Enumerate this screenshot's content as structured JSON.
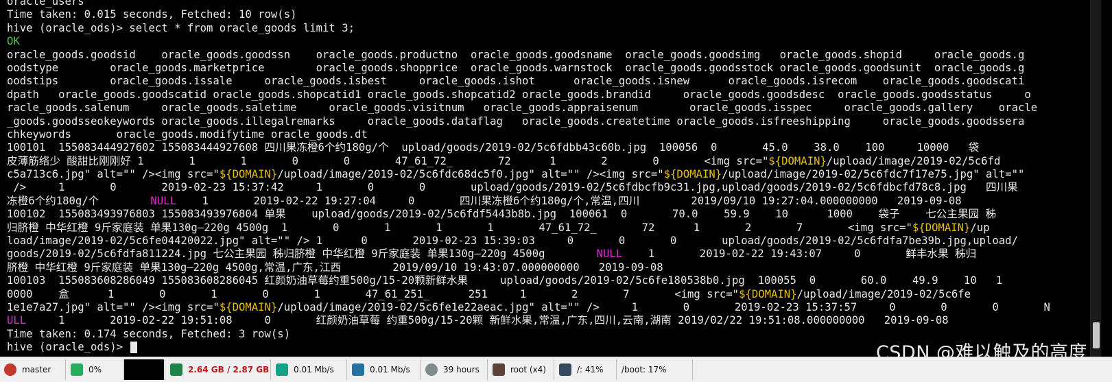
{
  "terminal": {
    "lines": [
      {
        "segments": [
          {
            "t": "oracle_users"
          }
        ]
      },
      {
        "segments": [
          {
            "t": "Time taken: 0.015 seconds, Fetched: 10 row(s)"
          }
        ]
      },
      {
        "segments": [
          {
            "t": "hive (oracle_ods)> select * from oracle_goods limit 3;"
          }
        ]
      },
      {
        "segments": [
          {
            "t": "OK",
            "c": "ok"
          }
        ]
      },
      {
        "segments": [
          {
            "t": "oracle_goods.goodsid    oracle_goods.goodssn    oracle_goods.productno  oracle_goods.goodsname  oracle_goods.goodsimg   oracle_goods.shopid     oracle_goods.g"
          }
        ]
      },
      {
        "segments": [
          {
            "t": "oodstype        oracle_goods.marketprice        oracle_goods.shopprice  oracle_goods.warnstock  oracle_goods.goodsstock oracle_goods.goodsunit  oracle_goods.g"
          }
        ]
      },
      {
        "segments": [
          {
            "t": "oodstips        oracle_goods.issale     oracle_goods.isbest     oracle_goods.ishot      oracle_goods.isnew      oracle_goods.isrecom    oracle_goods.goodscati"
          }
        ]
      },
      {
        "segments": [
          {
            "t": "dpath   oracle_goods.goodscatid oracle_goods.shopcatid1 oracle_goods.shopcatid2 oracle_goods.brandid     oracle_goods.goodsdesc  oracle_goods.goodsstatus     o"
          }
        ]
      },
      {
        "segments": [
          {
            "t": "racle_goods.salenum     oracle_goods.saletime     oracle_goods.visitnum   oracle_goods.appraisenum        oracle_goods.isspec     oracle_goods.gallery    oracle"
          }
        ]
      },
      {
        "segments": [
          {
            "t": "_goods.goodsseokeywords oracle_goods.illegalremarks     oracle_goods.dataflag   oracle_goods.createtime oracle_goods.isfreeshipping     oracle_goods.goodssera"
          }
        ]
      },
      {
        "segments": [
          {
            "t": "chkeywords       oracle_goods.modifytime oracle_goods.dt"
          }
        ]
      },
      {
        "segments": [
          {
            "t": "100101  155083444927602 155083444927608 四川果冻橙6个约180g/个  upload/goods/2019-02/5c6fdbb43c60b.jpg  100056  0       45.0    38.0    100     10000   袋"
          }
        ]
      },
      {
        "segments": [
          {
            "t": "皮薄筋络少 酸甜比刚刚好 1       1       1       0       0       47_61_72_       72      1       2       0       <img src=\""
          },
          {
            "t": "${DOMAIN}",
            "c": "domain"
          },
          {
            "t": "/upload/image/2019-02/5c6fd"
          }
        ]
      },
      {
        "segments": [
          {
            "t": "c5a713c6.jpg\" alt=\"\" /><img src=\""
          },
          {
            "t": "${DOMAIN}",
            "c": "domain"
          },
          {
            "t": "/upload/image/2019-02/5c6fdc68dc5f0.jpg\" alt=\"\" /><img src=\""
          },
          {
            "t": "${DOMAIN}",
            "c": "domain"
          },
          {
            "t": "/upload/image/2019-02/5c6fdc7f17e75.jpg\" alt=\"\""
          }
        ]
      },
      {
        "segments": [
          {
            "t": " />     1       0       2019-02-23 15:37:42     1       0       0       upload/goods/2019-02/5c6fdbcfb9c31.jpg,upload/goods/2019-02/5c6fdbcfd78c8.jpg   四川果"
          }
        ]
      },
      {
        "segments": [
          {
            "t": "冻橙6个约180g/个        "
          },
          {
            "t": "NULL",
            "c": "null"
          },
          {
            "t": "    1       2019-02-22 19:27:04     0       四川果冻橙6个约180g/个,常温,四川        2019/09/10 19:27:04.000000000   2019-09-08"
          }
        ]
      },
      {
        "segments": [
          {
            "t": "100102  155083493976803 155083493976804 单果    upload/goods/2019-02/5c6fdf5443b8b.jpg  100061  0       70.0    59.9    10      1000    袋子    七公主果园 秭"
          }
        ]
      },
      {
        "segments": [
          {
            "t": "归脐橙 中华红橙 9斤家庭装 单果130g—220g 4500g  1       0       1       1       1       47_61_72_       72      1       2       7       <img src=\""
          },
          {
            "t": "${DOMAIN}",
            "c": "domain"
          },
          {
            "t": "/up"
          }
        ]
      },
      {
        "segments": [
          {
            "t": "load/image/2019-02/5c6fe04420022.jpg\" alt=\"\" /> 1      0       2019-02-23 15:39:03     0       0       0       upload/goods/2019-02/5c6fdfa7be39b.jpg,upload/"
          }
        ]
      },
      {
        "segments": [
          {
            "t": "goods/2019-02/5c6fdfa811224.jpg 七公主果园 秭归脐橙 中华红橙 9斤家庭装 单果130g—220g 4500g        "
          },
          {
            "t": "NULL",
            "c": "null"
          },
          {
            "t": "    1       2019-02-22 19:43:07     0       鲜丰水果 秭归"
          }
        ]
      },
      {
        "segments": [
          {
            "t": "脐橙 中华红橙 9斤家庭装 单果130g—220g 4500g,常温,广东,江西        2019/09/10 19:43:07.000000000   2019-09-08"
          }
        ]
      },
      {
        "segments": [
          {
            "t": "100103  155083608286049 155083608286045 红颜奶油草莓约重500g/15-20颗新鲜水果     upload/goods/2019-02/5c6fe180538b0.jpg  100055  0       60.0    49.9    10   1"
          }
        ]
      },
      {
        "segments": [
          {
            "t": "0000    盒      1       0       1       0       1       47_61_251_      251     1       2       7       <img src=\""
          },
          {
            "t": "${DOMAIN}",
            "c": "domain"
          },
          {
            "t": "/upload/image/2019-02/5c6fe"
          }
        ]
      },
      {
        "segments": [
          {
            "t": "1e1e7a27.jpg\" alt=\"\" /><img src=\""
          },
          {
            "t": "${DOMAIN}",
            "c": "domain"
          },
          {
            "t": "/upload/image/2019-02/5c6fe1e22aeac.jpg\" alt=\"\" />     1       0       2019-02-23 15:37:57     0       0       0       N"
          }
        ]
      },
      {
        "segments": [
          {
            "t": "ULL",
            "c": "null"
          },
          {
            "t": "     1       2019-02-22 19:51:08     0       红颜奶油草莓 约重500g/15-20颗 新鲜水果,常温,广东,四川,云南,湖南 2019/02/22 19:51:08.000000000   2019-09-08"
          }
        ]
      },
      {
        "segments": [
          {
            "t": "Time taken: 0.174 seconds, Fetched: 3 row(s)"
          }
        ]
      },
      {
        "segments": [
          {
            "t": "hive (oracle_ods)> "
          }
        ],
        "cursor": true
      }
    ]
  },
  "watermark": "CSDN @难以触及的高度",
  "statusbar": {
    "items": [
      {
        "name": "git-branch",
        "icon": "branch-icon",
        "color": "#c0392b",
        "text": "master"
      },
      {
        "name": "cpu",
        "icon": "cpu-icon",
        "color": "#27ae60",
        "text": "0%"
      },
      {
        "name": "graph",
        "icon": "graph-icon",
        "color": "#000000",
        "text": ""
      },
      {
        "name": "memory",
        "icon": "memory-icon",
        "color": "#1e8449",
        "text": "2.64 GB / 2.87 GB"
      },
      {
        "name": "upload",
        "icon": "upload-icon",
        "color": "#16a085",
        "text": "0.01 Mb/s"
      },
      {
        "name": "download",
        "icon": "download-icon",
        "color": "#2471a3",
        "text": "0.01 Mb/s"
      },
      {
        "name": "uptime",
        "icon": "clock-icon",
        "color": "#7f8c8d",
        "text": "39 hours"
      },
      {
        "name": "user",
        "icon": "user-icon",
        "color": "#5d4037",
        "text": "root (x4)"
      },
      {
        "name": "disk-root",
        "icon": "disk-icon",
        "color": "#34495e",
        "text": "/: 41%"
      },
      {
        "name": "disk-boot",
        "icon": "",
        "color": "",
        "text": "/boot: 17%"
      }
    ]
  }
}
